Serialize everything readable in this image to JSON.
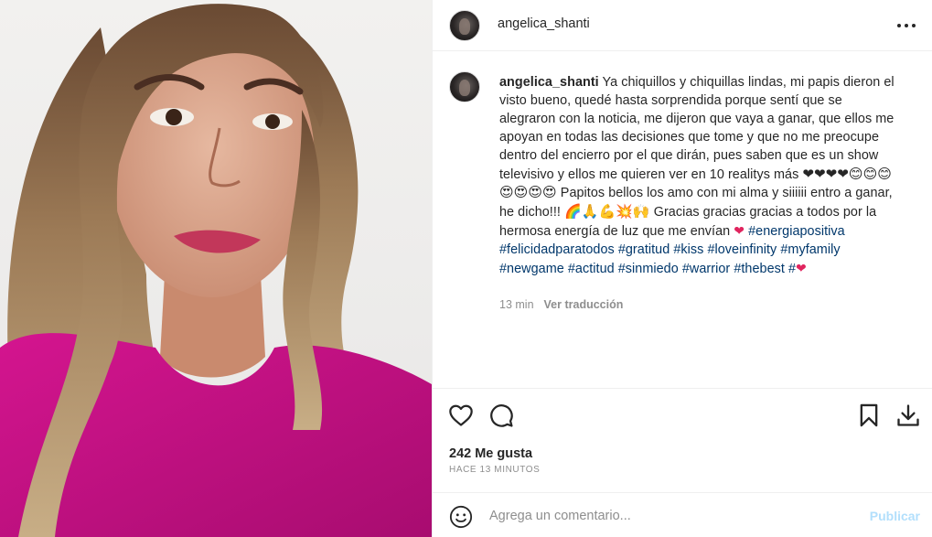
{
  "post": {
    "username": "angelica_shanti",
    "more_icon": "more-horizontal-icon",
    "photo_icon": "profile-photo-woman-pink-top"
  },
  "caption": {
    "username": "angelica_shanti",
    "line1": " Ya chiquillos y chiquillas lindas, mi papis dieron el visto bueno, quedé hasta sorprendida porque sentí que se alegraron con la noticia, me dijeron que vaya a ganar, que ellos me apoyan en todas las decisiones que tome y que no me preocupe dentro del encierro por el que dirán, pues saben que es un show televisivo y ellos me quieren ver en 10 realitys más",
    "emojis1": "❤❤❤❤😊😊😊😍😍😍😍",
    "line2": " Papitos bellos los amo con mi alma y siiiiii entro a ganar, he dicho!!! ",
    "emojis2": "🌈🙏💪💥🙌",
    "line3": " Gracias gracias gracias a todos por la hermosa energía de luz que me envían ",
    "heart": "❤",
    "hashtags": [
      "#energiapositiva",
      "#felicidadparatodos",
      "#gratitud",
      "#kiss",
      "#loveinfinity",
      "#myfamily",
      "#newgame",
      "#actitud",
      "#sinmiedo",
      "#warrior",
      "#thebest",
      "#"
    ],
    "end_heart": "❤",
    "time_ago": "13 min",
    "translate_label": "Ver traducción"
  },
  "actions": {
    "like_icon": "heart-outline-icon",
    "comment_icon": "comment-bubble-icon",
    "save_icon": "bookmark-icon",
    "download_icon": "download-icon"
  },
  "stats": {
    "likes": "242 Me gusta",
    "posted": "HACE 13 MINUTOS"
  },
  "comment": {
    "emoji_icon": "smiley-icon",
    "placeholder": "Agrega un comentario...",
    "publish_label": "Publicar"
  },
  "colors": {
    "text": "#262626",
    "secondary": "#8e8e8e",
    "hashtag": "#00376b",
    "publish_disabled": "#b2dffc",
    "heart": "#e0245e",
    "divider": "#efefef"
  }
}
